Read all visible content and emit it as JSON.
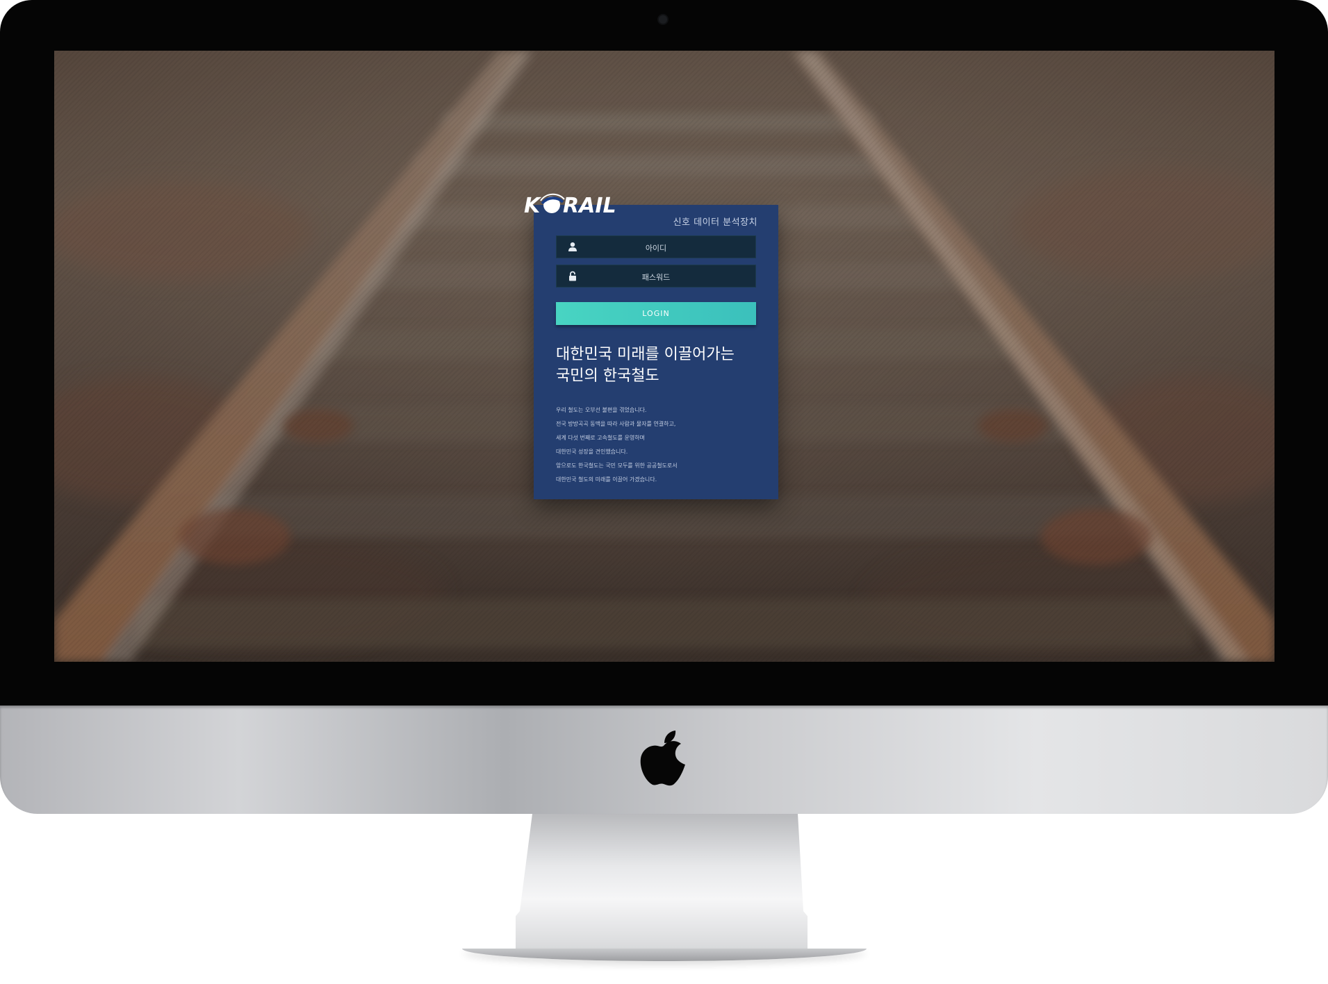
{
  "brand": {
    "logo_text": "KORAIL",
    "system_title": "신호 데이터 분석장치"
  },
  "login_form": {
    "id_placeholder": "아이디",
    "password_placeholder": "패스워드",
    "login_label": "LOGIN",
    "user_icon": "user-icon",
    "lock_icon": "lock-icon"
  },
  "intro": {
    "headline_line1": "대한민국 미래를 이끌어가는",
    "headline_line2": "국민의 한국철도",
    "description_lines": [
      "우리 철도는 오부선 불편을 겪었습니다.",
      "전국 방방곡곡 동맥을 따라 사람과 물자를 연결하고,",
      "세계 다섯 번째로 고속철도를 운영하며",
      "대한민국 성장을 견인했습니다.",
      "앞으로도 한국철도는 국민 모두를 위한 공공철도로서",
      "대한민국 철도의 미래를 이끌어 가겠습니다."
    ]
  },
  "device": {
    "apple_logo": "apple-logo-icon"
  },
  "colors": {
    "card": "#243e70",
    "input": "#142b3d",
    "login_button": "#48d4c2",
    "bezel": "#050505"
  }
}
